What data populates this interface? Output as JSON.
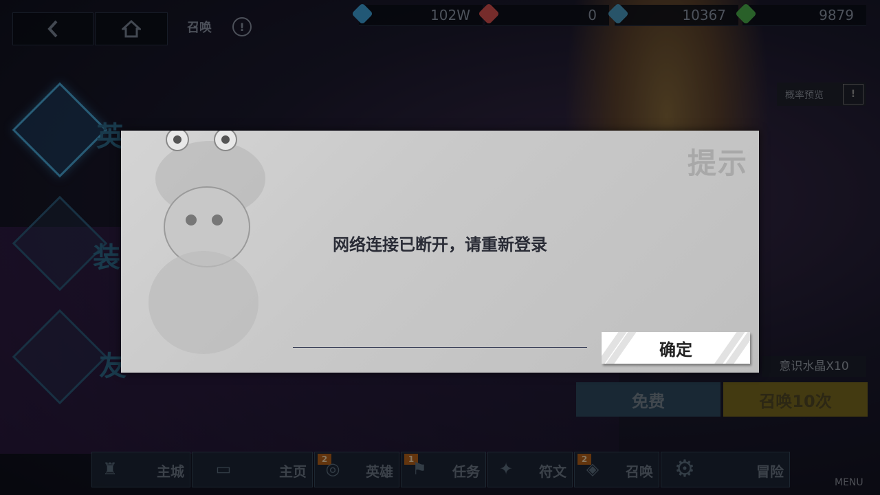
{
  "header": {
    "back_icon": "chevron-left-icon",
    "home_icon": "home-icon",
    "title": "召唤",
    "info_icon": "info-icon"
  },
  "resources": [
    {
      "name": "diamond",
      "icon": "blue-gem-icon",
      "color": "#3fa0d8",
      "value": "102W"
    },
    {
      "name": "heart",
      "icon": "heart-icon",
      "color": "#d8504f",
      "value": "0"
    },
    {
      "name": "crystal",
      "icon": "crystal-icon",
      "color": "#4a9ac0",
      "value": "10367"
    },
    {
      "name": "leaf",
      "icon": "green-leaf-icon",
      "color": "#4caf4c",
      "value": "9879"
    }
  ],
  "probability_preview": {
    "label": "概率预览",
    "icon": "exclamation-icon"
  },
  "side_tabs": [
    {
      "label": "英",
      "active": true
    },
    {
      "label": "装",
      "active": false
    },
    {
      "label": "友",
      "active": false
    }
  ],
  "summon_panel": {
    "reward_text": "意识水晶X10",
    "free_label": "免费",
    "summon10_label": "召唤10次"
  },
  "bottom_nav": [
    {
      "label": "主城",
      "icon": "castle-icon",
      "badge": ""
    },
    {
      "label": "主页",
      "icon": "home-sign-icon",
      "badge": ""
    },
    {
      "label": "英雄",
      "icon": "hero-icon",
      "badge": "2"
    },
    {
      "label": "任务",
      "icon": "quest-icon",
      "badge": "1"
    },
    {
      "label": "符文",
      "icon": "rune-icon",
      "badge": ""
    },
    {
      "label": "召唤",
      "icon": "summon-icon",
      "badge": "2"
    },
    {
      "label": "冒险",
      "icon": "adventure-gear-icon",
      "badge": ""
    }
  ],
  "menu_label": "MENU",
  "dialog": {
    "title": "提示",
    "message": "网络连接已断开，请重新登录",
    "confirm_label": "确定"
  }
}
